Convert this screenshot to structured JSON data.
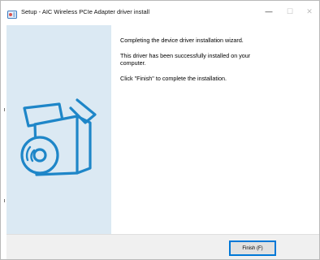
{
  "window": {
    "title": "Setup - AIC Wireless PCIe Adapter driver install",
    "controls": {
      "minimize": "—",
      "maximize": "☐",
      "close": "✕"
    }
  },
  "content": {
    "heading": "Completing the device driver installation wizard.",
    "message_success": "This driver has been successfully installed on your computer.",
    "message_finish": "Click \"Finish\" to complete the installation."
  },
  "footer": {
    "finish_label": "Finish (F)"
  },
  "colors": {
    "left_panel": "#dbe9f3",
    "art_stroke": "#1e86c8",
    "button_border": "#0078d7"
  },
  "icons": {
    "app": "setup-app-icon",
    "art": "software-box-with-disc-icon"
  }
}
